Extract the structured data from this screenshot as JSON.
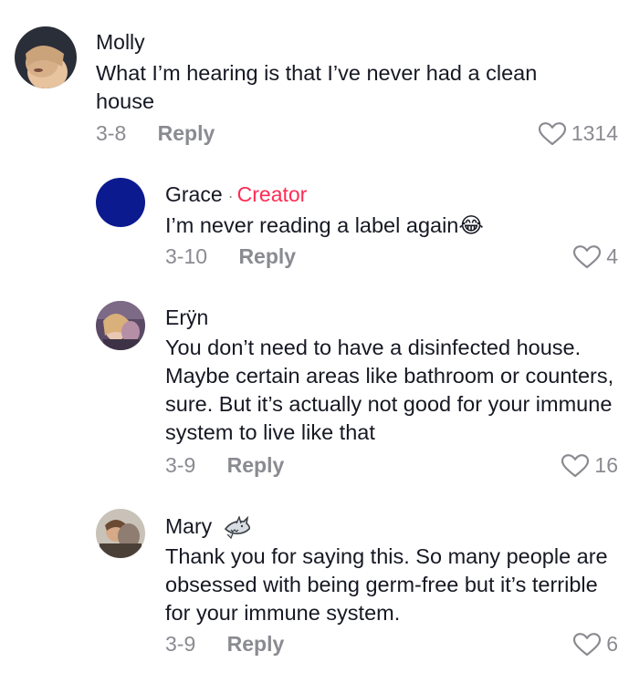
{
  "comments": [
    {
      "author": "Molly",
      "text": "What I’m hearing is that I’ve never had a clean house",
      "date": "3-8",
      "reply_label": "Reply",
      "likes": "1314"
    },
    {
      "author": "Grace",
      "separator": "·",
      "badge": "Creator",
      "text": "I’m never reading a label again😂",
      "date": "3-10",
      "reply_label": "Reply",
      "likes": "4",
      "avatar_color": "#0b1a8f"
    },
    {
      "author": "Erÿn",
      "text": "You don’t need to have a disinfected house. Maybe certain areas like bathroom or counters, sure. But it’s actually not good for your immune system to live like that",
      "date": "3-9",
      "reply_label": "Reply",
      "likes": "16"
    },
    {
      "author": "Mary",
      "author_emoji": "shark-icon",
      "text": "Thank you for saying this. So many people are obsessed with being germ-free but it’s terrible for your immune system.",
      "date": "3-9",
      "reply_label": "Reply",
      "likes": "6"
    }
  ],
  "colors": {
    "text": "#161823",
    "secondary": "#8a8b91",
    "creator_badge": "#fe2c55"
  }
}
